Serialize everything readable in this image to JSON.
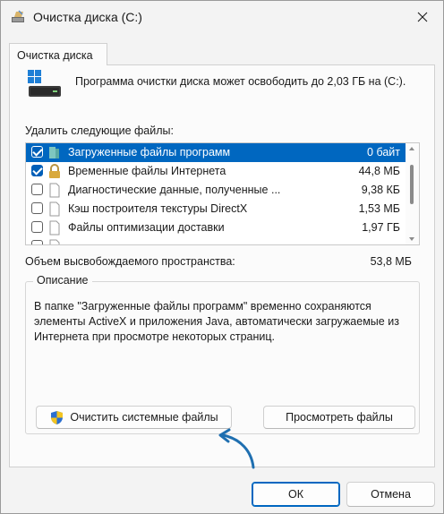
{
  "window": {
    "title": "Очистка диска  (C:)",
    "tab_label": "Очистка диска"
  },
  "intro_text": "Программа очистки диска может освободить до 2,03 ГБ на (C:).",
  "files_label": "Удалить следующие файлы:",
  "files": [
    {
      "name": "Загруженные файлы программ",
      "size": "0 байт",
      "checked": true,
      "selected": true,
      "icon": "folder-icon"
    },
    {
      "name": "Временные файлы Интернета",
      "size": "44,8 МБ",
      "checked": true,
      "selected": false,
      "icon": "lock-icon"
    },
    {
      "name": "Диагностические данные, полученные ...",
      "size": "9,38 КБ",
      "checked": false,
      "selected": false,
      "icon": "document-icon"
    },
    {
      "name": "Кэш построителя текстуры DirectX",
      "size": "1,53 МБ",
      "checked": false,
      "selected": false,
      "icon": "document-icon"
    },
    {
      "name": "Файлы оптимизации доставки",
      "size": "1,97 ГБ",
      "checked": false,
      "selected": false,
      "icon": "document-icon"
    },
    {
      "name": "",
      "size": "",
      "checked": false,
      "selected": false,
      "icon": "document-icon"
    }
  ],
  "space_label": "Объем высвобождаемого пространства:",
  "space_value": "53,8 МБ",
  "description": {
    "title": "Описание",
    "text": "В папке \"Загруженные файлы программ\" временно сохраняются элементы ActiveX и приложения Java, автоматически загружаемые из Интернета при просмотре некоторых страниц."
  },
  "buttons": {
    "clean_system": "Очистить системные файлы",
    "view_files": "Просмотреть файлы",
    "ok": "ОК",
    "cancel": "Отмена"
  },
  "colors": {
    "selection": "#0067c0",
    "checkbox": "#005fb8",
    "annotation_arrow": "#1f6fb0"
  }
}
